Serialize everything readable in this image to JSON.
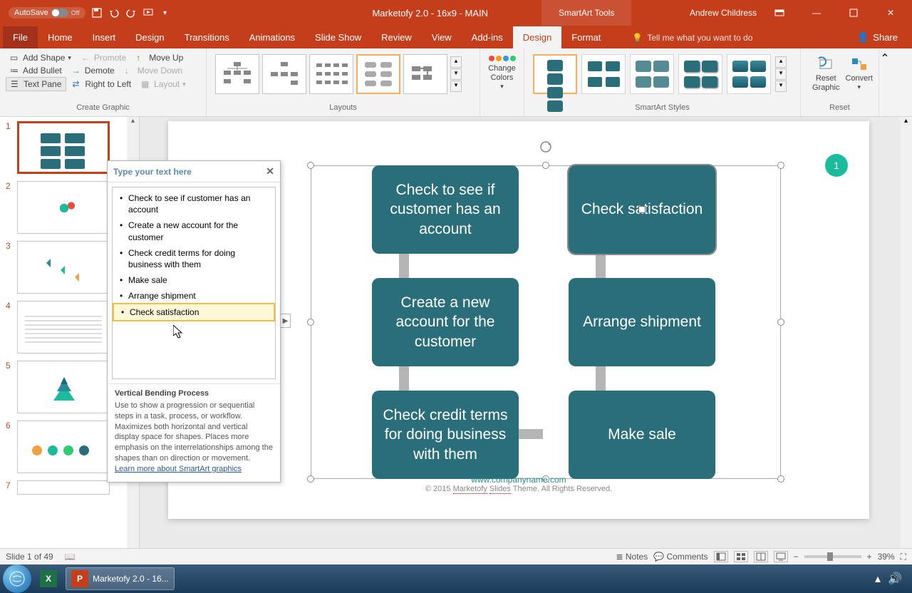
{
  "titlebar": {
    "autosave": "AutoSave",
    "autosave_state": "Off",
    "title": "Marketofy 2.0 - 16x9 - MAIN",
    "tools": "SmartArt Tools",
    "user": "Andrew Childress"
  },
  "tabs": {
    "file": "File",
    "home": "Home",
    "insert": "Insert",
    "design": "Design",
    "transitions": "Transitions",
    "animations": "Animations",
    "slideshow": "Slide Show",
    "review": "Review",
    "view": "View",
    "addins": "Add-ins",
    "sa_design": "Design",
    "format": "Format",
    "tellme": "Tell me what you want to do",
    "share": "Share"
  },
  "ribbon": {
    "create_graphic": {
      "add_shape": "Add Shape",
      "add_bullet": "Add Bullet",
      "text_pane": "Text Pane",
      "promote": "Promote",
      "demote": "Demote",
      "rtl": "Right to Left",
      "move_up": "Move Up",
      "move_down": "Move Down",
      "layout": "Layout",
      "label": "Create Graphic"
    },
    "layouts_label": "Layouts",
    "change_colors": "Change Colors",
    "styles_label": "SmartArt Styles",
    "reset_graphic": "Reset Graphic",
    "convert": "Convert",
    "reset_label": "Reset"
  },
  "textpane": {
    "header": "Type your text here",
    "items": [
      "Check to see if customer has an account",
      "Create a new account for the customer",
      "Check credit terms for doing business with them",
      "Make sale",
      "Arrange shipment",
      "Check satisfaction"
    ],
    "desc_title": "Vertical Bending Process",
    "desc_body": "Use to show a progression or sequential steps in a task, process, or workflow. Maximizes both horizontal and vertical display space for shapes. Places more emphasis on the interrelationships among the shapes than on direction or movement.",
    "learn_more": "Learn more about SmartArt graphics"
  },
  "smartart": {
    "box1": "Check to see if customer has an account",
    "box2": "Check satisfaction",
    "box3": "Create a new account for the customer",
    "box4": "Arrange shipment",
    "box5": "Check credit terms for doing business with them",
    "box6": "Make sale"
  },
  "slide": {
    "badge": "1",
    "url": "www.companyname.com",
    "copyright": "© 2015 Marketofy Slides Theme. All Rights Reserved."
  },
  "slides": {
    "nums": [
      "1",
      "2",
      "3",
      "4",
      "5",
      "6",
      "7"
    ]
  },
  "statusbar": {
    "slide": "Slide 1 of 49",
    "notes": "Notes",
    "comments": "Comments",
    "zoom": "39%"
  },
  "taskbar": {
    "powerpoint": "Marketofy 2.0 - 16..."
  },
  "colors": {
    "accent": "#2a6e7a",
    "brand": "#c43e1c",
    "badge": "#1bbc9b"
  }
}
